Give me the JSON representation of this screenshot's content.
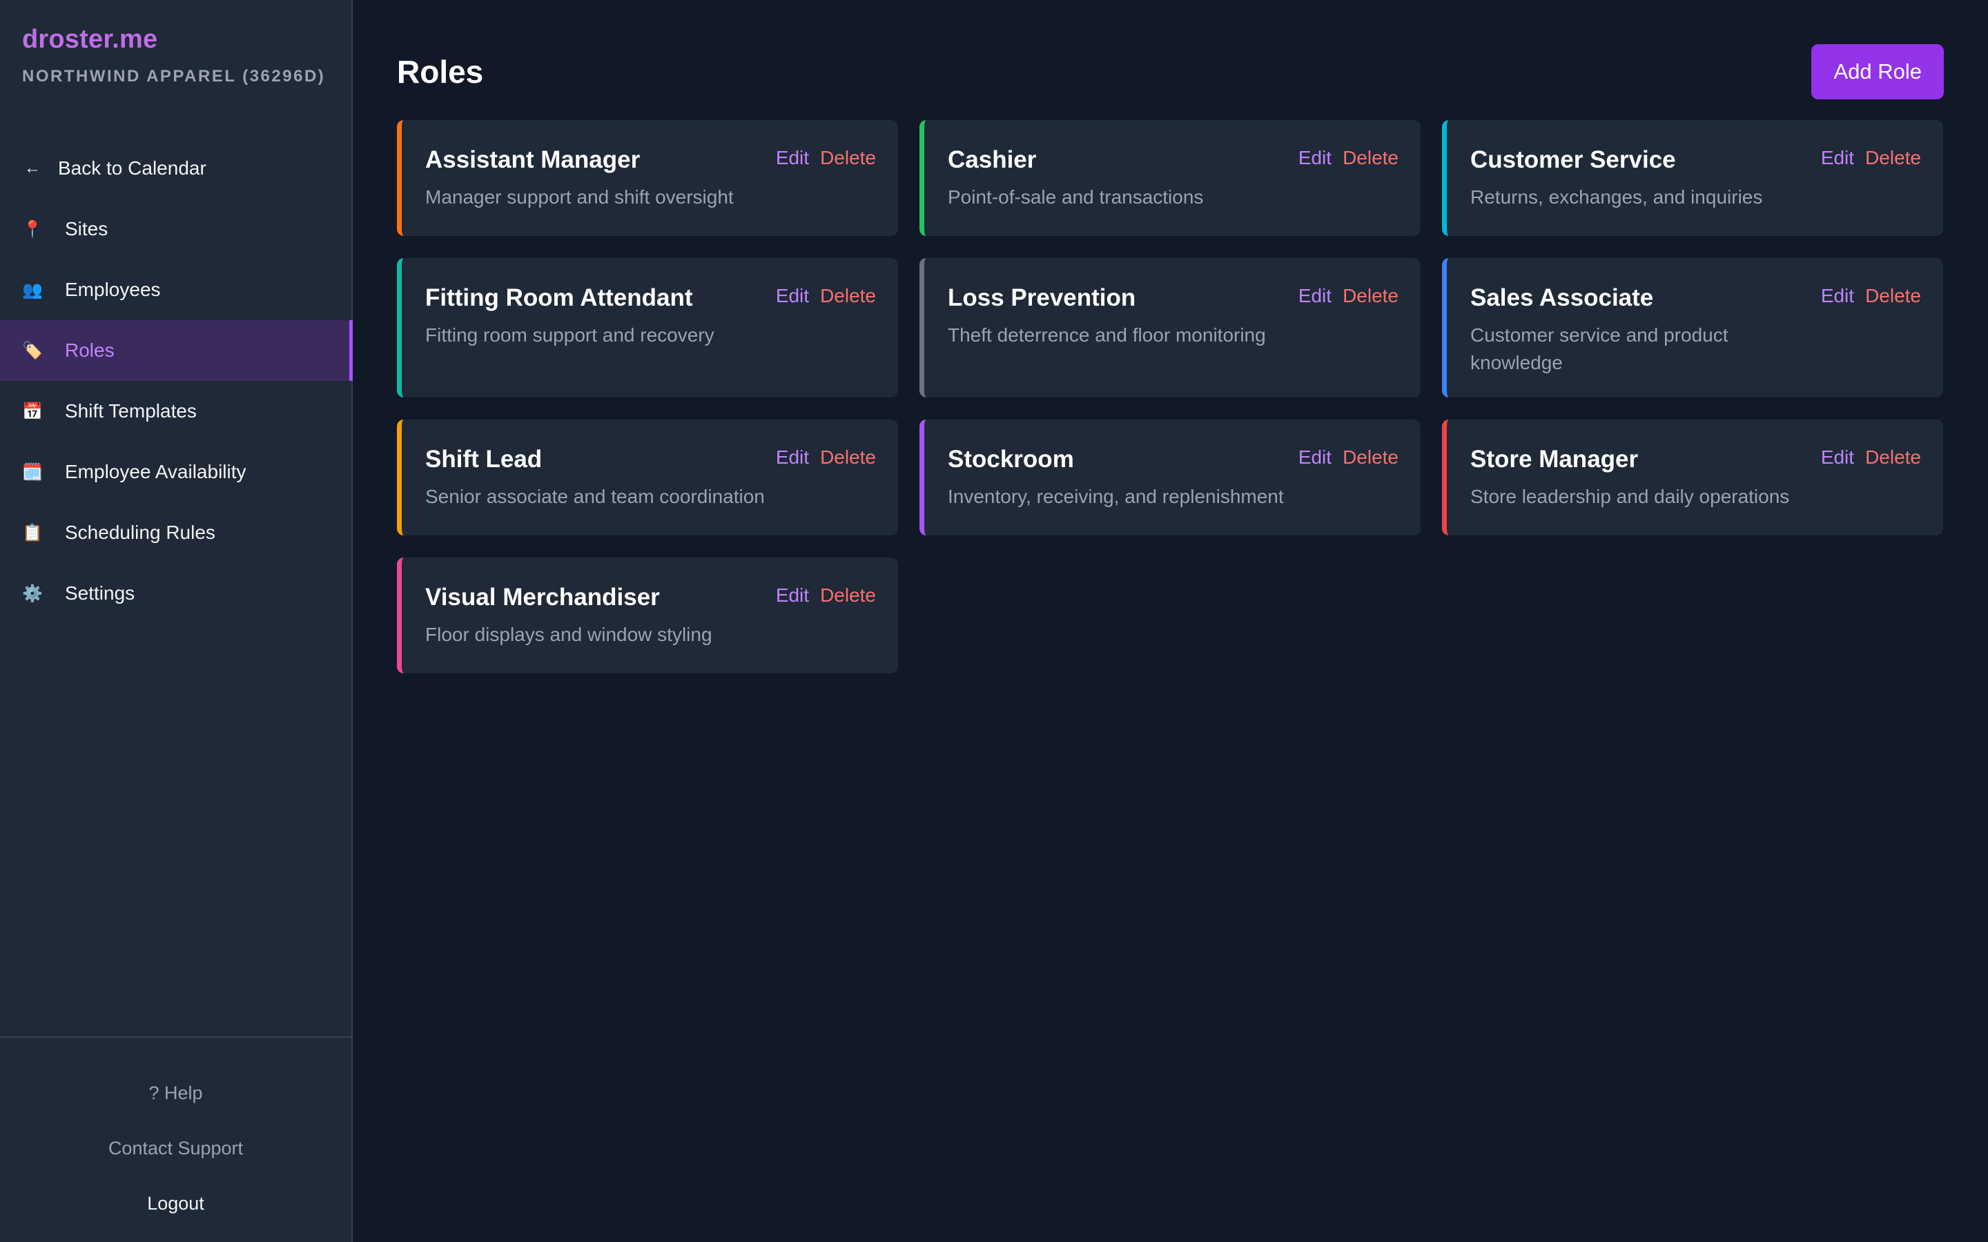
{
  "brand": {
    "name": "droster.me",
    "org": "NORTHWIND APPAREL (36296D)"
  },
  "sidebar": {
    "items": [
      {
        "label": "Back to Calendar",
        "icon": "arrow-left-icon",
        "glyph": "←"
      },
      {
        "label": "Sites",
        "icon": "pin-icon",
        "glyph": "📍"
      },
      {
        "label": "Employees",
        "icon": "people-icon",
        "glyph": "👥"
      },
      {
        "label": "Roles",
        "icon": "tag-icon",
        "glyph": "🏷️"
      },
      {
        "label": "Shift Templates",
        "icon": "calendar-icon",
        "glyph": "📅"
      },
      {
        "label": "Employee Availability",
        "icon": "calendar-page-icon",
        "glyph": "🗓️"
      },
      {
        "label": "Scheduling Rules",
        "icon": "clipboard-icon",
        "glyph": "📋"
      },
      {
        "label": "Settings",
        "icon": "gear-icon",
        "glyph": "⚙️"
      }
    ],
    "active_index": 3,
    "footer": {
      "help": "? Help",
      "contact": "Contact Support",
      "logout": "Logout"
    }
  },
  "main": {
    "title": "Roles",
    "add_label": "Add Role",
    "edit_label": "Edit",
    "delete_label": "Delete"
  },
  "colors": {
    "accent": "#9333ea",
    "brand": "#c06ee8",
    "edit": "#c084fc",
    "delete": "#f87171"
  },
  "roles": [
    {
      "name": "Assistant Manager",
      "description": "Manager support and shift oversight",
      "color": "#f97316"
    },
    {
      "name": "Cashier",
      "description": "Point-of-sale and transactions",
      "color": "#22c55e"
    },
    {
      "name": "Customer Service",
      "description": "Returns, exchanges, and inquiries",
      "color": "#06b6d4"
    },
    {
      "name": "Fitting Room Attendant",
      "description": "Fitting room support and recovery",
      "color": "#14b8a6"
    },
    {
      "name": "Loss Prevention",
      "description": "Theft deterrence and floor monitoring",
      "color": "#6b7280"
    },
    {
      "name": "Sales Associate",
      "description": "Customer service and product knowledge",
      "color": "#3b82f6"
    },
    {
      "name": "Shift Lead",
      "description": "Senior associate and team coordination",
      "color": "#f59e0b"
    },
    {
      "name": "Stockroom",
      "description": "Inventory, receiving, and replenishment",
      "color": "#a855f7"
    },
    {
      "name": "Store Manager",
      "description": "Store leadership and daily operations",
      "color": "#ef4444"
    },
    {
      "name": "Visual Merchandiser",
      "description": "Floor displays and window styling",
      "color": "#ec4899"
    }
  ]
}
